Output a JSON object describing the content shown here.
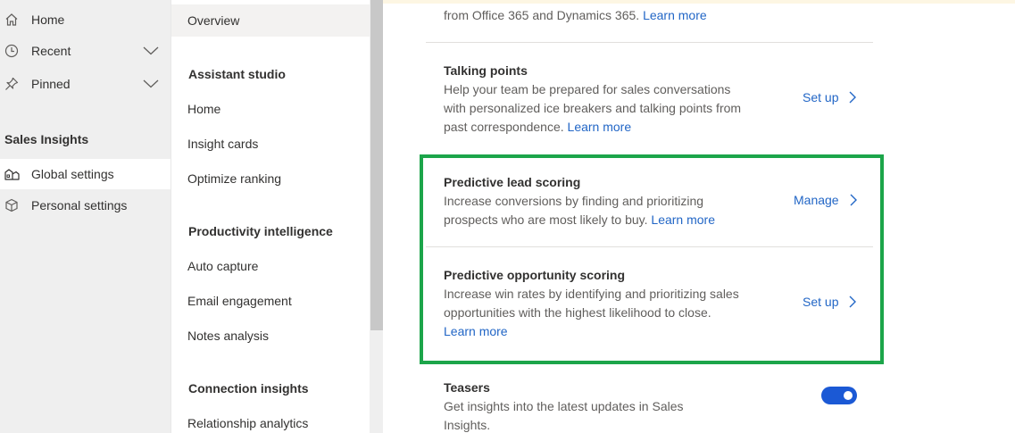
{
  "left_nav": {
    "items": [
      {
        "label": "Home",
        "icon": "home-icon"
      },
      {
        "label": "Recent",
        "icon": "clock-icon",
        "has_chevron": true
      },
      {
        "label": "Pinned",
        "icon": "pin-icon",
        "has_chevron": true
      }
    ],
    "section_title": "Sales Insights",
    "section_items": [
      {
        "label": "Global settings",
        "icon": "global-settings-icon",
        "selected": true
      },
      {
        "label": "Personal settings",
        "icon": "cube-icon",
        "selected": false
      }
    ]
  },
  "sub_nav": {
    "overview": "Overview",
    "assistant_studio": {
      "title": "Assistant studio",
      "items": [
        "Home",
        "Insight cards",
        "Optimize ranking"
      ]
    },
    "productivity_intelligence": {
      "title": "Productivity intelligence",
      "items": [
        "Auto capture",
        "Email engagement",
        "Notes analysis"
      ]
    },
    "connection_insights": {
      "title": "Connection insights",
      "items": [
        "Relationship analytics"
      ]
    }
  },
  "main": {
    "top_fragment": {
      "text": "from Office 365 and Dynamics 365.",
      "link": "Learn more"
    },
    "talking_points": {
      "title": "Talking points",
      "desc_line1": "Help your team be prepared for sales conversations",
      "desc_line2": "with personalized ice breakers and talking points from",
      "desc_line3": "past correspondence.",
      "link": "Learn more",
      "action": "Set up"
    },
    "predictive_lead_scoring": {
      "title": "Predictive lead scoring",
      "desc_line1": "Increase conversions by finding and prioritizing",
      "desc_line2": "prospects who are most likely to buy.",
      "link": "Learn more",
      "action": "Manage"
    },
    "predictive_opportunity_scoring": {
      "title": "Predictive opportunity scoring",
      "desc_line1": "Increase win rates by identifying and prioritizing sales",
      "desc_line2": "opportunities with the highest likelihood to close.",
      "link": "Learn more",
      "action": "Set up"
    },
    "teasers": {
      "title": "Teasers",
      "desc_line1": "Get insights into the latest updates in Sales",
      "desc_line2": "Insights.",
      "toggle_on": true
    }
  },
  "colors": {
    "accent": "#2266c6",
    "highlight": "#1ca54a",
    "toggle": "#1b59d5"
  }
}
